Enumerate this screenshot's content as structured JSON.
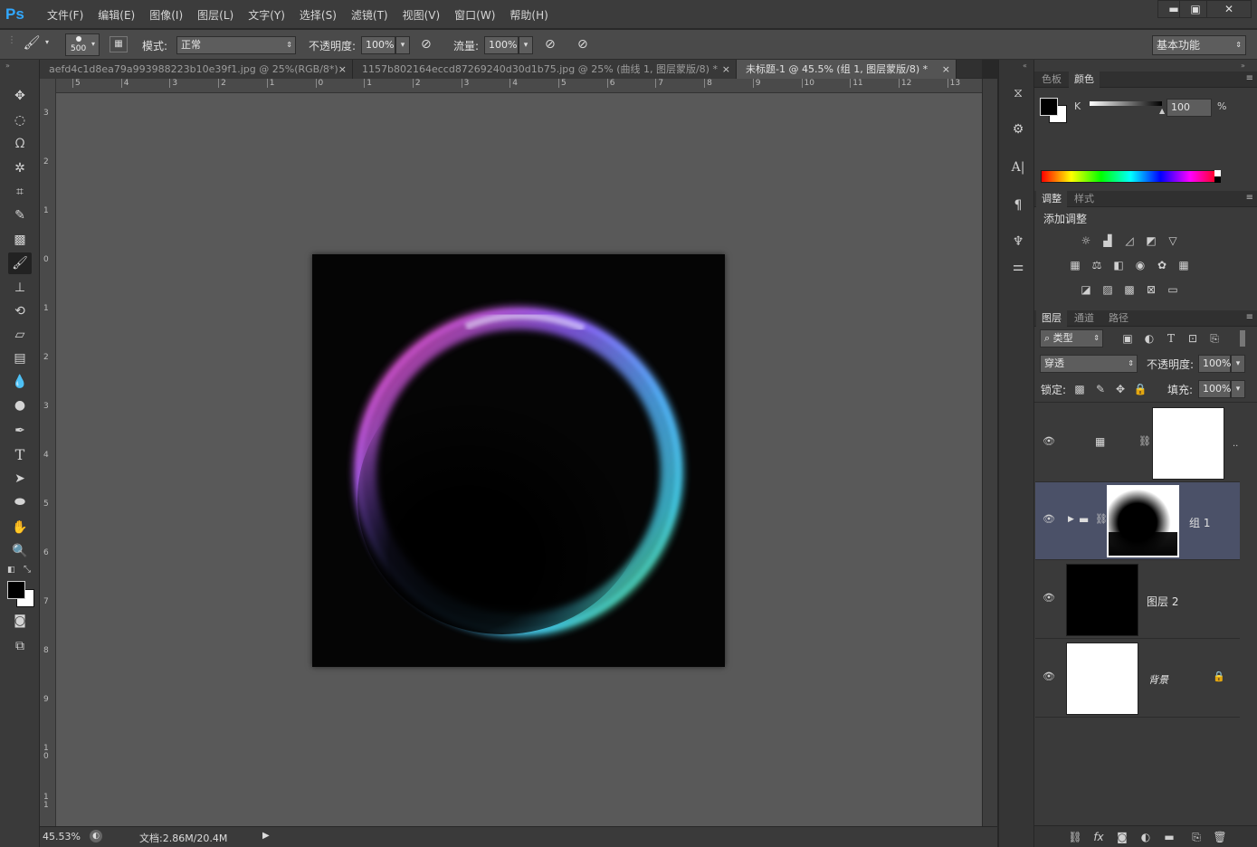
{
  "app": {
    "logo": "Ps"
  },
  "menu": [
    "文件(F)",
    "编辑(E)",
    "图像(I)",
    "图层(L)",
    "文字(Y)",
    "选择(S)",
    "滤镜(T)",
    "视图(V)",
    "窗口(W)",
    "帮助(H)"
  ],
  "window_controls": {
    "minimize": "▬",
    "maximize": "▣",
    "close": "✕"
  },
  "options": {
    "brush_size": "500",
    "mode_label": "模式:",
    "mode_value": "正常",
    "opacity_label": "不透明度:",
    "opacity_value": "100%",
    "flow_label": "流量:",
    "flow_value": "100%",
    "workspace": "基本功能"
  },
  "tabs": [
    {
      "label": "aefd4c1d8ea79a993988223b10e39f1.jpg @ 25%(RGB/8*)",
      "close": "×"
    },
    {
      "label": "1157b802164eccd87269240d30d1b75.jpg @ 25% (曲线 1, 图层蒙版/8) *",
      "close": "×"
    },
    {
      "label": "未标题-1 @ 45.5% (组 1, 图层蒙版/8) *",
      "close": "×"
    }
  ],
  "ruler_h": [
    "5",
    "4",
    "3",
    "2",
    "1",
    "0",
    "1",
    "2",
    "3",
    "4",
    "5",
    "6",
    "7",
    "8",
    "9",
    "10",
    "11",
    "12",
    "13"
  ],
  "ruler_v": [
    "3",
    "2",
    "1",
    "0",
    "1",
    "2",
    "3",
    "4",
    "5",
    "6",
    "7",
    "8",
    "9",
    "1 0",
    "1 1"
  ],
  "status": {
    "zoom": "45.53%",
    "doc": "文档:2.86M/20.4M"
  },
  "color_panel": {
    "tabs": [
      "色板",
      "颜色"
    ],
    "channel": "K",
    "value": "100",
    "unit": "%"
  },
  "adjust_panel": {
    "tabs": [
      "调整",
      "样式"
    ],
    "title": "添加调整"
  },
  "layers_panel": {
    "tabs": [
      "图层",
      "通道",
      "路径"
    ],
    "filter": "类型",
    "blend": "穿透",
    "opacity_label": "不透明度:",
    "opacity": "100%",
    "lock_label": "锁定:",
    "fill_label": "填充:",
    "fill": "100%",
    "layers": [
      {
        "name": "",
        "type": "adjustment"
      },
      {
        "name": "组 1",
        "type": "group"
      },
      {
        "name": "图层 2",
        "type": "layer"
      },
      {
        "name": "背景",
        "type": "background"
      }
    ]
  },
  "colors": {
    "accent": "#31a8ff",
    "selected_layer": "#4b5168",
    "workspace": "#595959"
  }
}
